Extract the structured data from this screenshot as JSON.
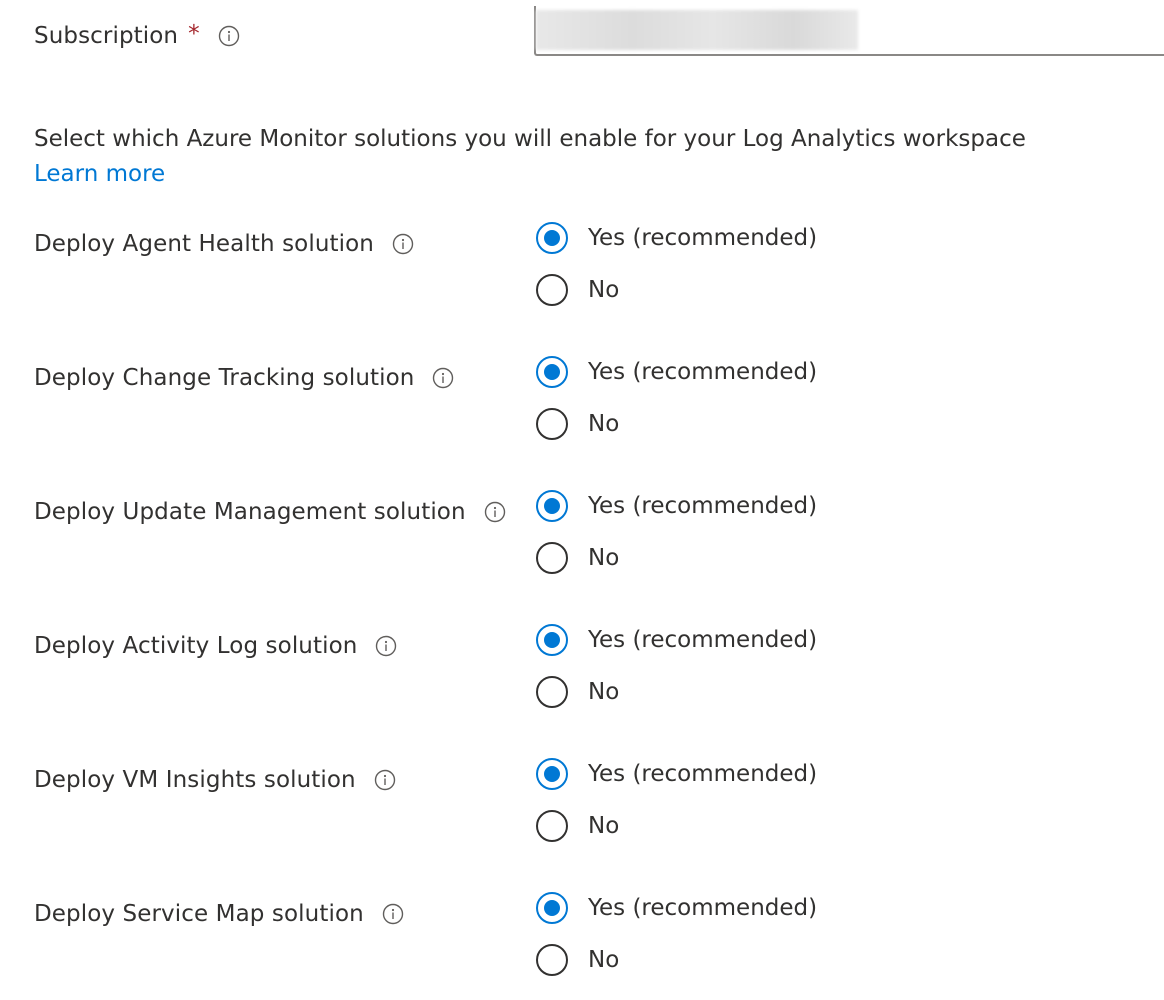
{
  "subscription": {
    "label": "Subscription",
    "required_marker": "*",
    "value": ""
  },
  "intro": {
    "text": "Select which Azure Monitor solutions you will enable for your Log Analytics workspace",
    "link_label": "Learn more"
  },
  "solutions": [
    {
      "label": "Deploy Agent Health solution",
      "options": [
        {
          "label": "Yes (recommended)",
          "checked": true
        },
        {
          "label": "No",
          "checked": false
        }
      ]
    },
    {
      "label": "Deploy Change Tracking solution",
      "options": [
        {
          "label": "Yes (recommended)",
          "checked": true
        },
        {
          "label": "No",
          "checked": false
        }
      ]
    },
    {
      "label": "Deploy Update Management solution",
      "options": [
        {
          "label": "Yes (recommended)",
          "checked": true
        },
        {
          "label": "No",
          "checked": false
        }
      ]
    },
    {
      "label": "Deploy Activity Log solution",
      "options": [
        {
          "label": "Yes (recommended)",
          "checked": true
        },
        {
          "label": "No",
          "checked": false
        }
      ]
    },
    {
      "label": "Deploy VM Insights solution",
      "options": [
        {
          "label": "Yes (recommended)",
          "checked": true
        },
        {
          "label": "No",
          "checked": false
        }
      ]
    },
    {
      "label": "Deploy Service Map solution",
      "options": [
        {
          "label": "Yes (recommended)",
          "checked": true
        },
        {
          "label": "No",
          "checked": false
        }
      ]
    }
  ],
  "colors": {
    "accent": "#0078d4",
    "required": "#a4262c",
    "text": "#323130"
  },
  "icons": {
    "info": "info-circle-icon"
  }
}
